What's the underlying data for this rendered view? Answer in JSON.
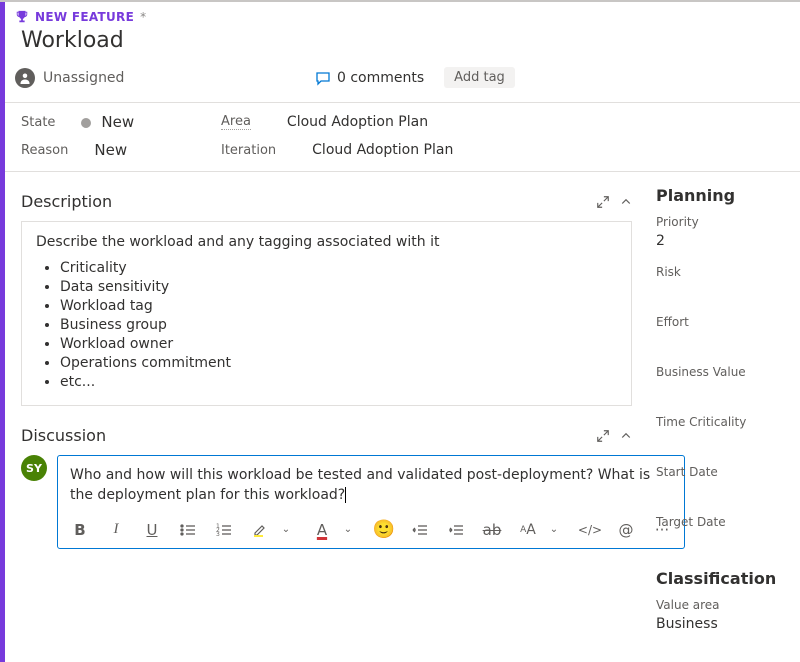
{
  "header": {
    "type_label": "NEW FEATURE",
    "dirty_marker": "*",
    "title": "Workload",
    "assignee": "Unassigned",
    "comments_label": "0 comments",
    "add_tag_label": "Add tag"
  },
  "state_block": {
    "state_label": "State",
    "state_value": "New",
    "area_label": "Area",
    "area_value": "Cloud Adoption Plan",
    "reason_label": "Reason",
    "reason_value": "New",
    "iteration_label": "Iteration",
    "iteration_value": "Cloud Adoption Plan"
  },
  "description": {
    "heading": "Description",
    "intro": "Describe the workload and any tagging associated with it",
    "bullets": [
      "Criticality",
      "Data sensitivity",
      "Workload tag",
      "Business group",
      "Workload owner",
      "Operations commitment",
      "etc..."
    ]
  },
  "discussion": {
    "heading": "Discussion",
    "avatar_initials": "SY",
    "draft_text": "Who and how will this workload be tested and validated post-deployment? What is the deployment plan for this workload?"
  },
  "planning": {
    "heading": "Planning",
    "priority_label": "Priority",
    "priority_value": "2",
    "risk_label": "Risk",
    "risk_value": "",
    "effort_label": "Effort",
    "effort_value": "",
    "bv_label": "Business Value",
    "bv_value": "",
    "tc_label": "Time Criticality",
    "tc_value": "",
    "start_label": "Start Date",
    "start_value": "",
    "target_label": "Target Date",
    "target_value": ""
  },
  "classification": {
    "heading": "Classification",
    "va_label": "Value area",
    "va_value": "Business"
  }
}
